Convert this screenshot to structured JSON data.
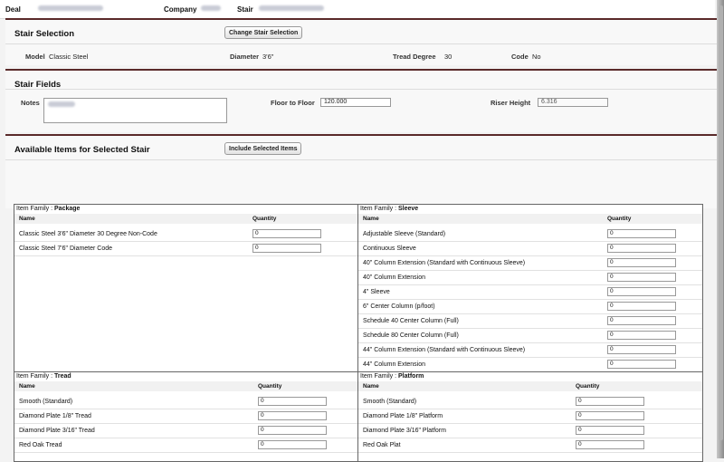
{
  "header": {
    "deal_label": "Deal",
    "company_label": "Company",
    "stair_label": "Stair"
  },
  "stair_selection": {
    "title": "Stair Selection",
    "change_button": "Change Stair Selection",
    "model_label": "Model",
    "model_value": "Classic Steel",
    "diameter_label": "Diameter",
    "diameter_value": "3'6\"",
    "tread_degree_label": "Tread Degree",
    "tread_degree_value": "30",
    "code_label": "Code",
    "code_value": "No"
  },
  "stair_fields": {
    "title": "Stair Fields",
    "notes_label": "Notes",
    "floor_to_floor_label": "Floor to Floor",
    "floor_to_floor_value": "120.000",
    "riser_height_label": "Riser Height",
    "riser_height_value": "6.316"
  },
  "available_items": {
    "title": "Available Items for Selected Stair",
    "include_button": "Include Selected Items"
  },
  "panels": {
    "family_prefix": "Item Family :",
    "name_header": "Name",
    "quantity_header": "Quantity",
    "package": {
      "family": "Package",
      "rows": [
        {
          "name": "Classic Steel 3'6\" Diameter 30 Degree Non-Code",
          "qty": "0"
        },
        {
          "name": "Classic Steel 7'6\" Diameter Code",
          "qty": "0"
        }
      ]
    },
    "sleeve": {
      "family": "Sleeve",
      "rows": [
        {
          "name": "Adjustable Sleeve (Standard)",
          "qty": "0"
        },
        {
          "name": "Continuous Sleeve",
          "qty": "0"
        },
        {
          "name": "40\" Column Extension (Standard with Continuous Sleeve)",
          "qty": "0"
        },
        {
          "name": "40\" Column Extension",
          "qty": "0"
        },
        {
          "name": "4\" Sleeve",
          "qty": "0"
        },
        {
          "name": "6\" Center Column (p/foot)",
          "qty": "0"
        },
        {
          "name": "Schedule 40 Center Column (Full)",
          "qty": "0"
        },
        {
          "name": "Schedule 80 Center Column (Full)",
          "qty": "0"
        },
        {
          "name": "44\" Column Extension (Standard with Continuous Sleeve)",
          "qty": "0"
        },
        {
          "name": "44\" Column Extension",
          "qty": "0"
        }
      ]
    },
    "tread": {
      "family": "Tread",
      "rows": [
        {
          "name": "Smooth (Standard)",
          "qty": "0"
        },
        {
          "name": "Diamond Plate 1/8\" Tread",
          "qty": "0"
        },
        {
          "name": "Diamond Plate 3/16\" Tread",
          "qty": "0"
        },
        {
          "name": "Red Oak Tread",
          "qty": "0"
        }
      ]
    },
    "platform": {
      "family": "Platform",
      "rows": [
        {
          "name": "Smooth (Standard)",
          "qty": "0"
        },
        {
          "name": "Diamond Plate 1/8\" Platform",
          "qty": "0"
        },
        {
          "name": "Diamond Plate 3/16\" Platform",
          "qty": "0"
        },
        {
          "name": "Red Oak Plat",
          "qty": "0"
        }
      ]
    }
  }
}
